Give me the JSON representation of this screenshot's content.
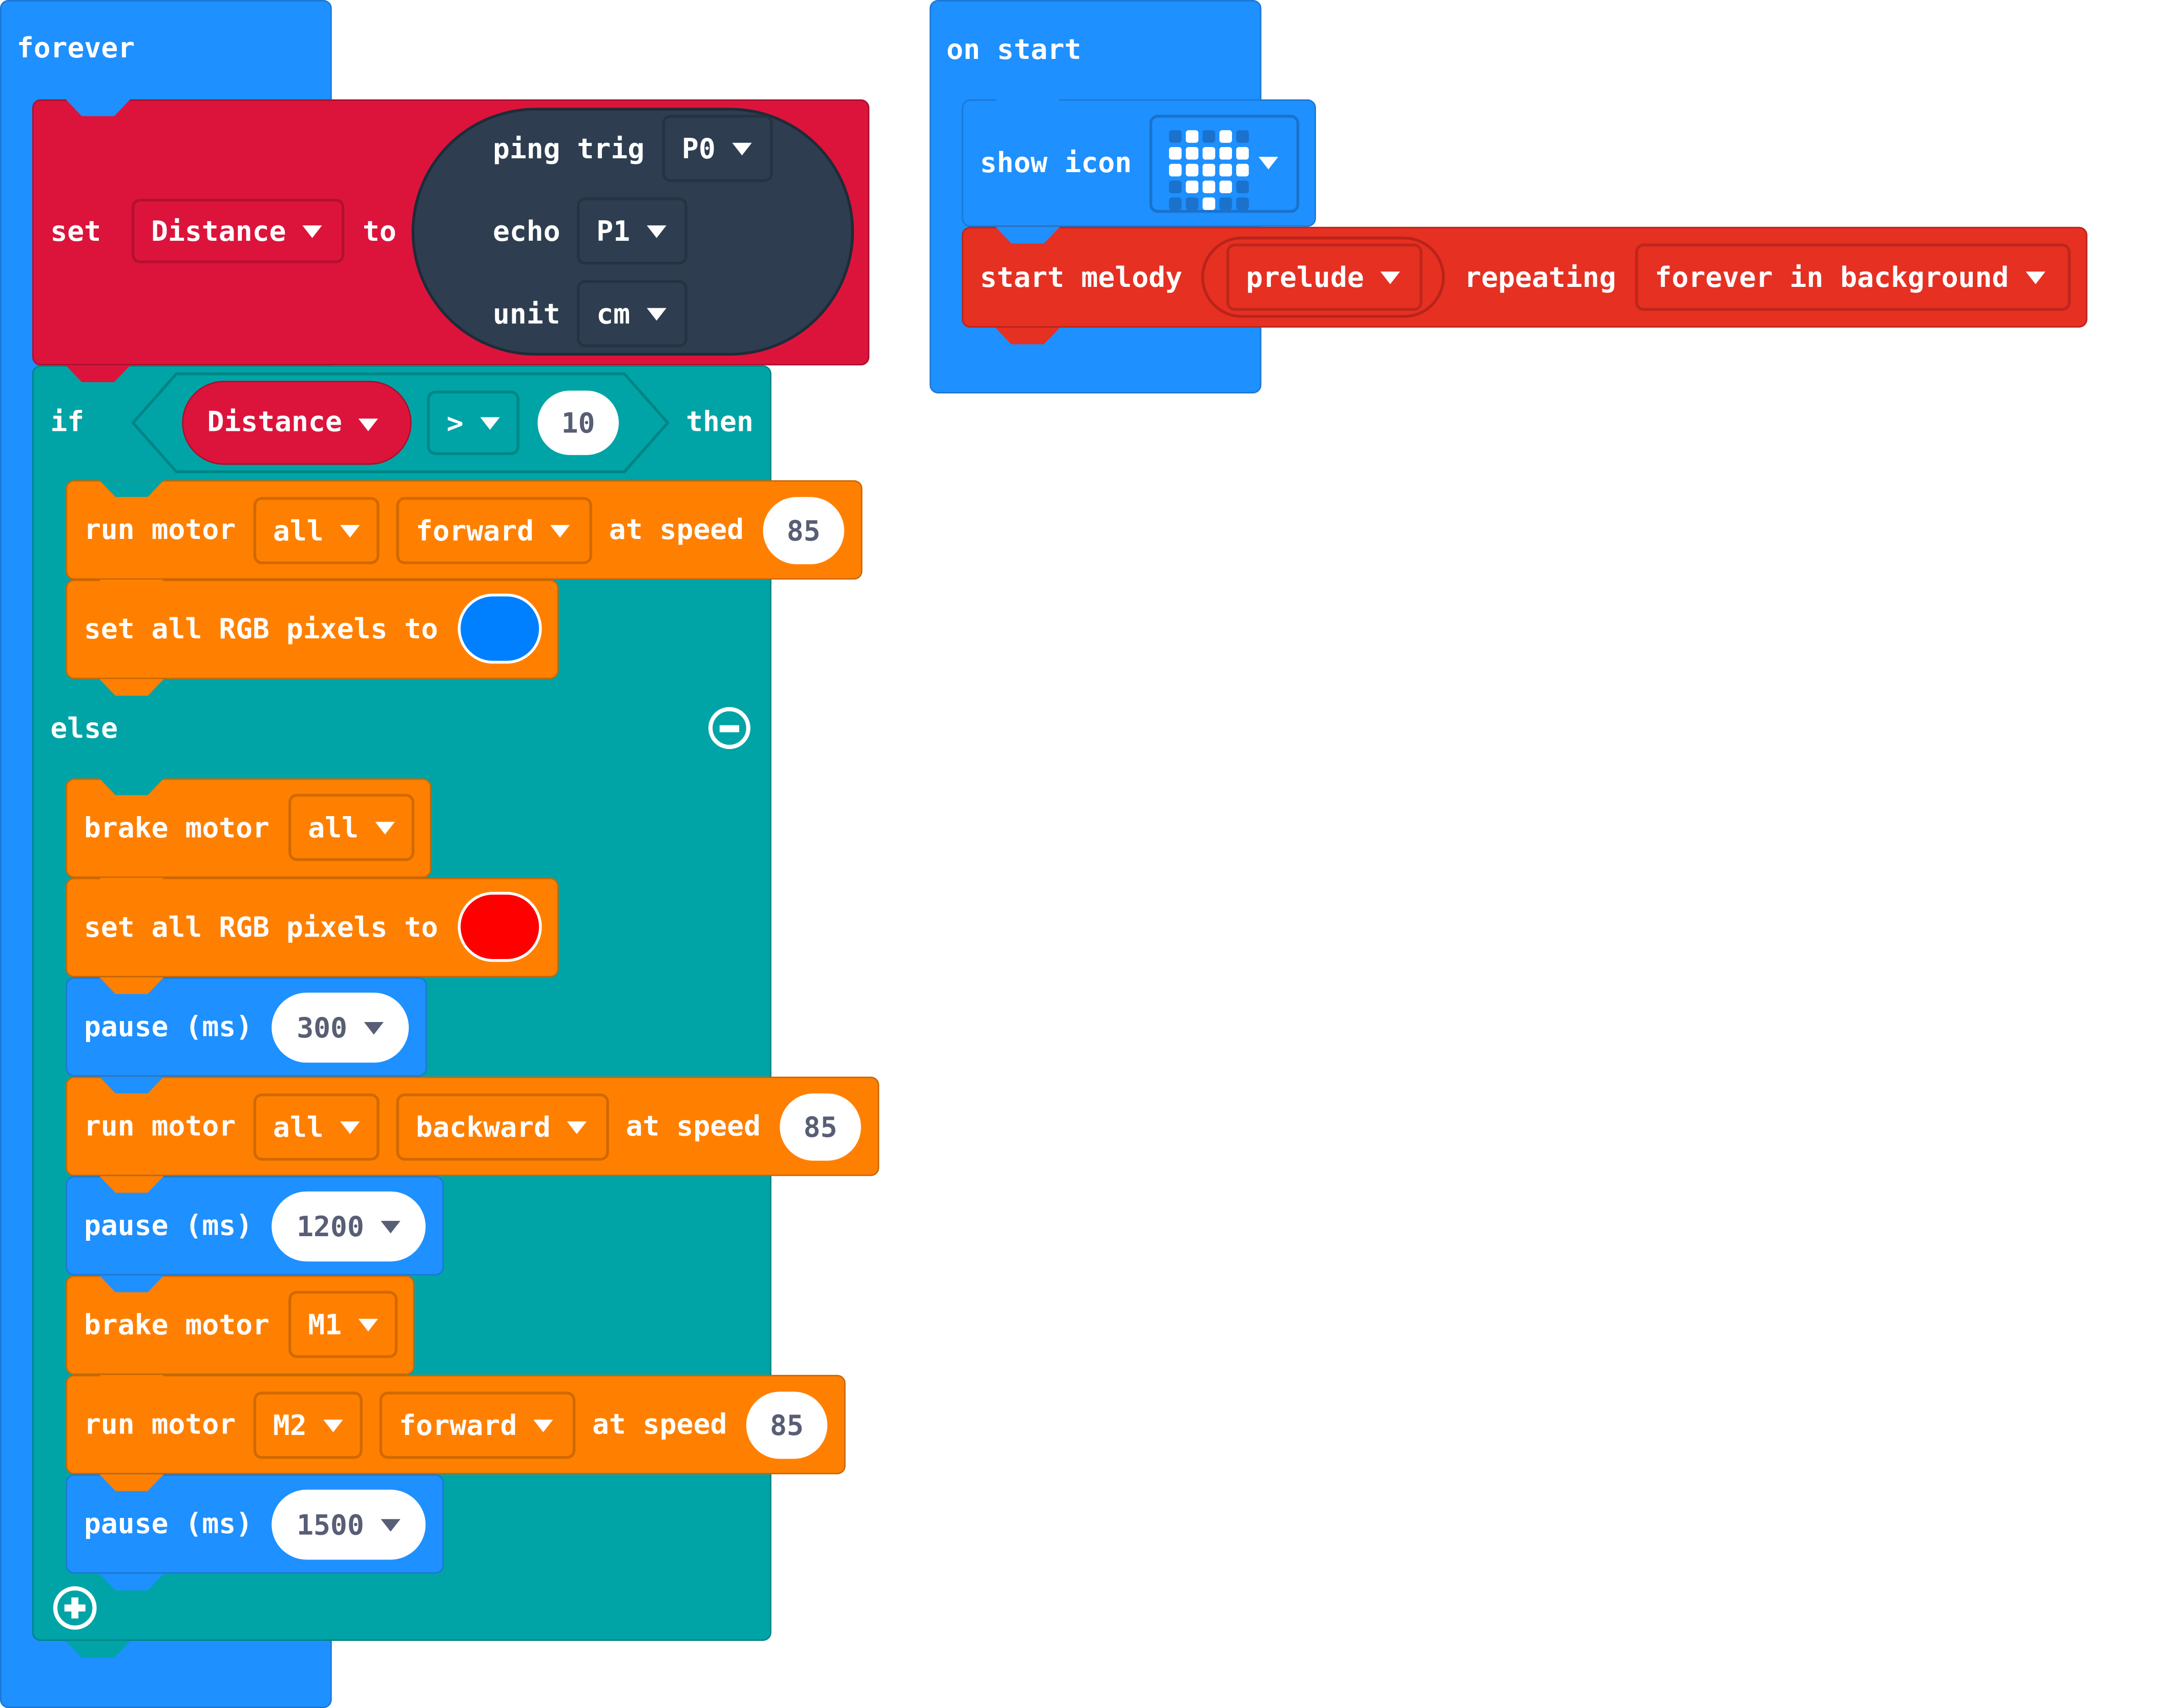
{
  "colors": {
    "basic_blue": "#1e90ff",
    "variables_crimson": "#dc143c",
    "logic_teal": "#00a4a6",
    "motor_orange": "#ff8000",
    "music_red": "#e63022",
    "sonar_navy": "#2e3e50",
    "rgb_blue": "#0080ff",
    "rgb_red": "#ff0000"
  },
  "forever": {
    "label": "forever",
    "set_block": {
      "set_label": "set",
      "variable": "Distance",
      "to_label": "to",
      "sonar": {
        "ping_trig_label": "ping trig",
        "trig_pin": "P0",
        "echo_label": "echo",
        "echo_pin": "P1",
        "unit_label": "unit",
        "unit": "cm"
      }
    },
    "if_block": {
      "if_label": "if",
      "condition": {
        "variable": "Distance",
        "operator": ">",
        "value": "10"
      },
      "then_label": "then",
      "then_body": [
        {
          "type": "run_motor",
          "label": "run motor",
          "motor": "all",
          "direction": "forward",
          "speed_label": "at speed",
          "speed": "85"
        },
        {
          "type": "set_rgb",
          "label": "set all RGB pixels to",
          "color": "#0080ff"
        }
      ],
      "else_label": "else",
      "else_body": [
        {
          "type": "brake_motor",
          "label": "brake motor",
          "motor": "all"
        },
        {
          "type": "set_rgb",
          "label": "set all RGB pixels to",
          "color": "#ff0000"
        },
        {
          "type": "pause",
          "label": "pause (ms)",
          "value": "300"
        },
        {
          "type": "run_motor",
          "label": "run motor",
          "motor": "all",
          "direction": "backward",
          "speed_label": "at speed",
          "speed": "85"
        },
        {
          "type": "pause",
          "label": "pause (ms)",
          "value": "1200"
        },
        {
          "type": "brake_motor",
          "label": "brake motor",
          "motor": "M1"
        },
        {
          "type": "run_motor",
          "label": "run motor",
          "motor": "M2",
          "direction": "forward",
          "speed_label": "at speed",
          "speed": "85"
        },
        {
          "type": "pause",
          "label": "pause (ms)",
          "value": "1500"
        }
      ],
      "remove_else_icon": "minus-circle-icon",
      "add_else_icon": "plus-circle-icon"
    }
  },
  "on_start": {
    "label": "on start",
    "show_icon": {
      "label": "show icon",
      "icon": "heart",
      "pattern": [
        [
          0,
          1,
          0,
          1,
          0
        ],
        [
          1,
          1,
          1,
          1,
          1
        ],
        [
          1,
          1,
          1,
          1,
          1
        ],
        [
          0,
          1,
          1,
          1,
          0
        ],
        [
          0,
          0,
          1,
          0,
          0
        ]
      ]
    },
    "start_melody": {
      "label": "start melody",
      "melody": "prelude",
      "repeat_label": "repeating",
      "repeat_mode": "forever in background"
    }
  }
}
